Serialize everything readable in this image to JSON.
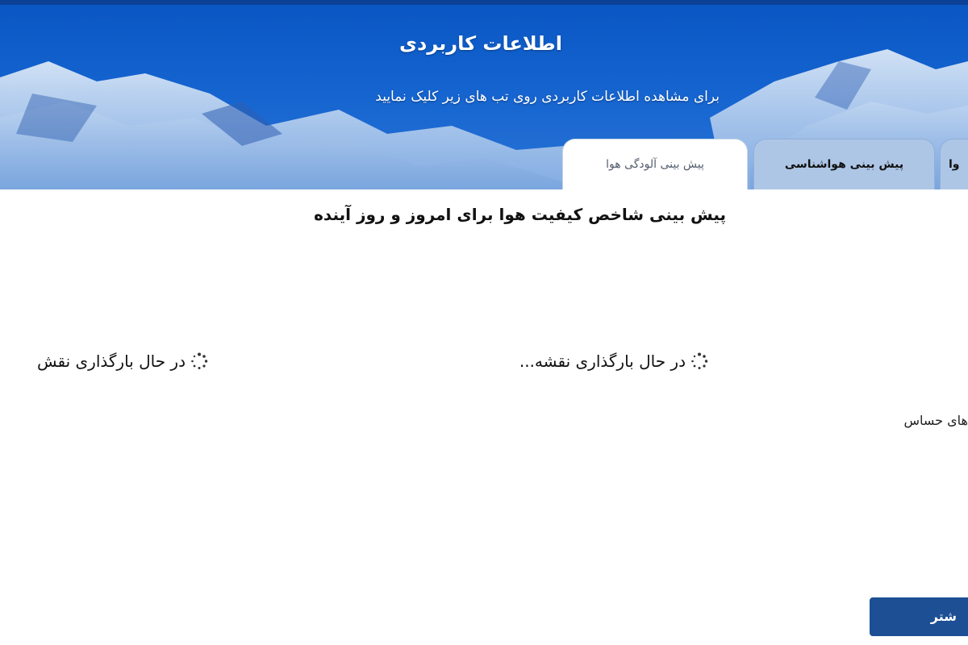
{
  "header": {
    "title": "اطلاعات کاربردی",
    "subtitle": "برای مشاهده اطلاعات کاربردی روی تب های زیر کلیک نمایید"
  },
  "tabs": [
    {
      "label": "پیش بینی آلودگی هوا",
      "active": true
    },
    {
      "label": "پیش بینی هواشناسی",
      "active": false
    },
    {
      "label": "وا",
      "active": false
    }
  ],
  "content": {
    "heading": "پیش بینی شاخص کیفیت هوا برای امروز و روز آینده",
    "loading_center": "در حال بارگذاری نقشه...",
    "loading_left": "در حال بارگذاری نقش",
    "sensitive_text": "های حساس",
    "more_button": "شتر"
  },
  "colors": {
    "banner": "#1463cf",
    "active_tab": "#ffffff",
    "inactive_tab": "#aec6e6",
    "button": "#1d4f95"
  },
  "icons": {
    "loading": "spinner-icon",
    "banner_background": "mountain-background"
  }
}
